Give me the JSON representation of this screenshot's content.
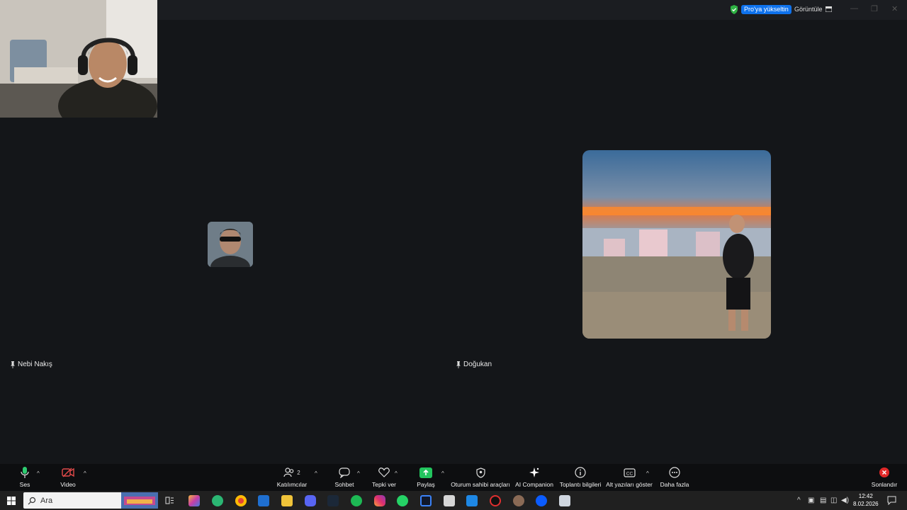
{
  "window": {
    "pro_badge": "Pro'ya yükseltin",
    "view_button": "Görüntüle",
    "minimize": "—",
    "maximize": "❐",
    "close": "✕"
  },
  "participants": [
    {
      "name": "Nebi Nakış"
    },
    {
      "name": "Doğukan"
    }
  ],
  "toolbar": {
    "audio": "Ses",
    "video": "Video",
    "participants": "Katılımcılar",
    "participants_count": "2",
    "chat": "Sohbet",
    "react": "Tepki ver",
    "share": "Paylaş",
    "host_tools": "Oturum sahibi araçları",
    "ai_companion": "AI Companion",
    "meeting_info": "Toplantı bilgileri",
    "captions": "Alt yazıları göster",
    "more": "Daha fazla",
    "end": "Sonlandır"
  },
  "taskbar": {
    "search_placeholder": "Ara",
    "time": "12:42",
    "date": "8.02.2026"
  },
  "colors": {
    "background": "#141619",
    "accent": "#0e72ed",
    "end_red": "#e02828",
    "share_green": "#22c55e"
  }
}
